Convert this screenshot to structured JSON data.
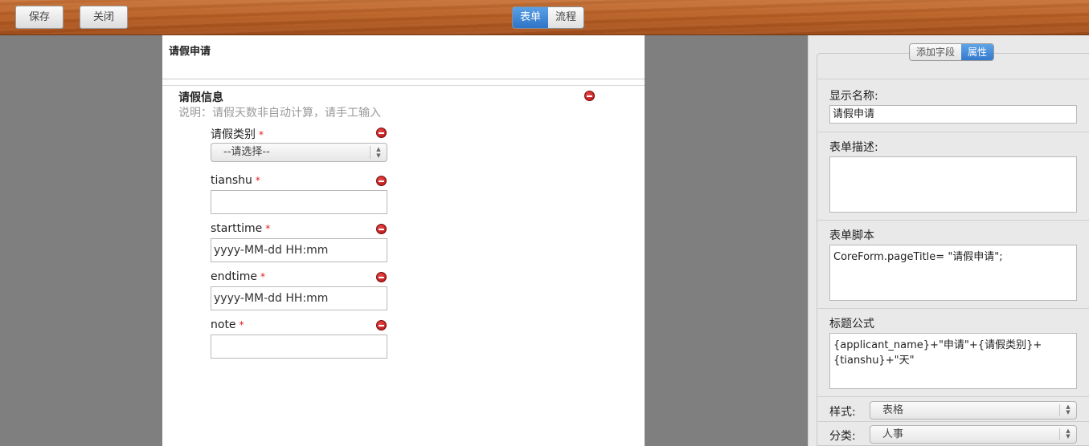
{
  "toolbar": {
    "save_label": "保存",
    "close_label": "关闭",
    "view_tabs": [
      {
        "label": "表单",
        "active": true
      },
      {
        "label": "流程",
        "active": false
      }
    ]
  },
  "form": {
    "title": "请假申请",
    "section": {
      "title": "请假信息",
      "description": "说明：请假天数非自动计算，请手工输入"
    },
    "fields": [
      {
        "label": "请假类别",
        "required_mark": "*",
        "type": "select",
        "value": "--请选择--"
      },
      {
        "label": "tianshu",
        "required_mark": "*",
        "type": "text",
        "value": ""
      },
      {
        "label": "starttime",
        "required_mark": "*",
        "type": "text",
        "value": "yyyy-MM-dd HH:mm"
      },
      {
        "label": "endtime",
        "required_mark": "*",
        "type": "text",
        "value": "yyyy-MM-dd HH:mm"
      },
      {
        "label": "note",
        "required_mark": "*",
        "type": "text",
        "value": ""
      }
    ]
  },
  "panel": {
    "tabs": [
      {
        "label": "添加字段",
        "active": false
      },
      {
        "label": "属性",
        "active": true
      }
    ],
    "display_name": {
      "label": "显示名称:",
      "value": "请假申请"
    },
    "form_desc": {
      "label": "表单描述:",
      "value": ""
    },
    "form_script": {
      "label": "表单脚本",
      "value": "CoreForm.pageTitle= \"请假申请\";"
    },
    "title_formula": {
      "label": "标题公式",
      "value": "{applicant_name}+\"申请\"+{请假类别}+\n{tianshu}+\"天\""
    },
    "style": {
      "label": "样式:",
      "value": "表格"
    },
    "category": {
      "label": "分类:",
      "value": "人事"
    }
  },
  "colors": {
    "accent": "#3479cc",
    "toolbar_wood": "#b95f24",
    "required": "#e02020"
  }
}
